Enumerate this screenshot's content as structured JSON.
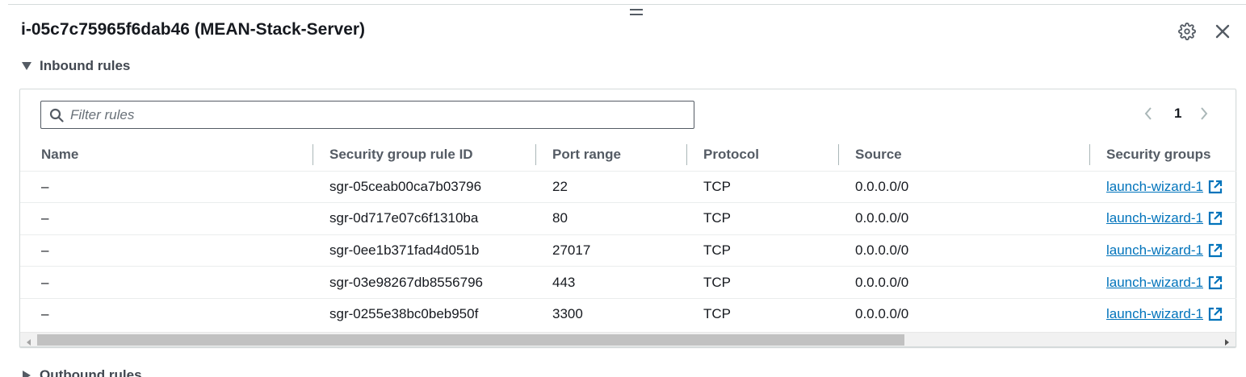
{
  "panel": {
    "title": "i-05c7c75965f6dab46 (MEAN-Stack-Server)",
    "settings_icon": "gear-icon",
    "close_icon": "close-icon"
  },
  "inbound": {
    "label": "Inbound rules",
    "filter_placeholder": "Filter rules",
    "pager": {
      "current_page": "1"
    },
    "columns": [
      "Name",
      "Security group rule ID",
      "Port range",
      "Protocol",
      "Source",
      "Security groups"
    ],
    "rows": [
      {
        "name": "–",
        "rule_id": "sgr-05ceab00ca7b03796",
        "port": "22",
        "protocol": "TCP",
        "source": "0.0.0.0/0",
        "security_group": "launch-wizard-1"
      },
      {
        "name": "–",
        "rule_id": "sgr-0d717e07c6f1310ba",
        "port": "80",
        "protocol": "TCP",
        "source": "0.0.0.0/0",
        "security_group": "launch-wizard-1"
      },
      {
        "name": "–",
        "rule_id": "sgr-0ee1b371fad4d051b",
        "port": "27017",
        "protocol": "TCP",
        "source": "0.0.0.0/0",
        "security_group": "launch-wizard-1"
      },
      {
        "name": "–",
        "rule_id": "sgr-03e98267db8556796",
        "port": "443",
        "protocol": "TCP",
        "source": "0.0.0.0/0",
        "security_group": "launch-wizard-1"
      },
      {
        "name": "–",
        "rule_id": "sgr-0255e38bc0beb950f",
        "port": "3300",
        "protocol": "TCP",
        "source": "0.0.0.0/0",
        "security_group": "launch-wizard-1"
      }
    ]
  },
  "outbound": {
    "label": "Outbound rules"
  },
  "colors": {
    "link": "#0073bb",
    "header_text": "#545b64",
    "text": "#16191f"
  }
}
